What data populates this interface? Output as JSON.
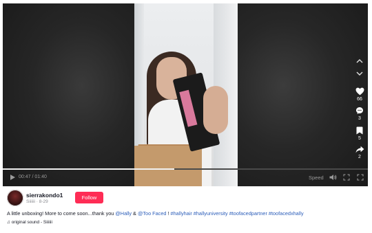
{
  "player": {
    "time_current": "00:47",
    "time_total": "01:40",
    "time_display": "00:47 / 01:40",
    "progress": 0.47,
    "speed_label": "Speed"
  },
  "rail": {
    "likes": "66",
    "comments": "3",
    "saves": "5",
    "shares": "2"
  },
  "author": {
    "username": "sierrakondo1",
    "display_name": "Siiiiii",
    "date": "8-29",
    "subline": "Siiiiii · 8-29",
    "follow_label": "Follow"
  },
  "caption": {
    "text_1": "A little unboxing! More to come soon...thank you ",
    "mention_1": "@Hally",
    "text_2": " & ",
    "mention_2": "@Too Faced",
    "text_3": " ! ",
    "hashtags": "#hallyhair #hallyuniversity #toofacedpartner #toofacedxhally"
  },
  "sound": {
    "label": "original sound - Siiiiii"
  },
  "colors": {
    "follow_button": "#fe2c55",
    "link": "#2b5db9",
    "text": "#161823"
  }
}
